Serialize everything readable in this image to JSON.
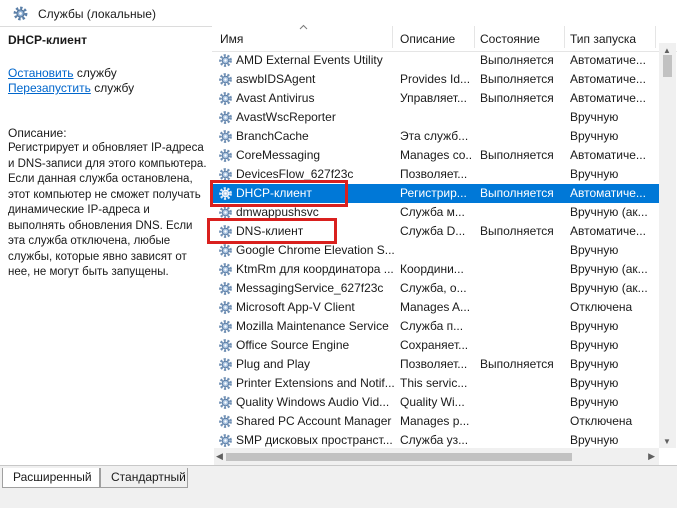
{
  "window": {
    "title": "Службы (локальные)",
    "title_icon": "gear-icon"
  },
  "left_pane": {
    "service_title": "DHCP-клиент",
    "actions": [
      {
        "link": "Остановить",
        "rest": " службу"
      },
      {
        "link": "Перезапустить",
        "rest": " службу"
      }
    ],
    "description_label": "Описание:",
    "description": "Регистрирует и обновляет IP-адреса и DNS-записи для этого компьютера. Если данная служба остановлена, этот компьютер не сможет получать динамические IP-адреса и выполнять обновления DNS. Если эта служба отключена, любые службы, которые явно зависят от нее, не могут быть запущены."
  },
  "columns": {
    "name": "Имя",
    "description": "Описание",
    "state": "Состояние",
    "startup": "Тип запуска"
  },
  "services": [
    {
      "name": "AMD External Events Utility",
      "description": "",
      "state": "Выполняется",
      "startup": "Автоматиче..."
    },
    {
      "name": "aswbIDSAgent",
      "description": "Provides Id...",
      "state": "Выполняется",
      "startup": "Автоматиче..."
    },
    {
      "name": "Avast Antivirus",
      "description": "Управляет...",
      "state": "Выполняется",
      "startup": "Автоматиче..."
    },
    {
      "name": "AvastWscReporter",
      "description": "",
      "state": "",
      "startup": "Вручную"
    },
    {
      "name": "BranchCache",
      "description": "Эта служб...",
      "state": "",
      "startup": "Вручную"
    },
    {
      "name": "CoreMessaging",
      "description": "Manages co...",
      "state": "Выполняется",
      "startup": "Автоматиче..."
    },
    {
      "name": "DevicesFlow_627f23c",
      "description": "Позволяет...",
      "state": "",
      "startup": "Вручную"
    },
    {
      "name": "DHCP-клиент",
      "description": "Регистрир...",
      "state": "Выполняется",
      "startup": "Автоматиче...",
      "selected": true
    },
    {
      "name": "dmwappushsvc",
      "description": "Служба м...",
      "state": "",
      "startup": "Вручную (ак..."
    },
    {
      "name": "DNS-клиент",
      "description": "Служба D...",
      "state": "Выполняется",
      "startup": "Автоматиче..."
    },
    {
      "name": "Google Chrome Elevation S...",
      "description": "",
      "state": "",
      "startup": "Вручную"
    },
    {
      "name": "KtmRm для координатора ...",
      "description": "Координи...",
      "state": "",
      "startup": "Вручную (ак..."
    },
    {
      "name": "MessagingService_627f23c",
      "description": "Служба, о...",
      "state": "",
      "startup": "Вручную (ак..."
    },
    {
      "name": "Microsoft App-V Client",
      "description": "Manages A...",
      "state": "",
      "startup": "Отключена"
    },
    {
      "name": "Mozilla Maintenance Service",
      "description": "Служба п...",
      "state": "",
      "startup": "Вручную"
    },
    {
      "name": "Office  Source Engine",
      "description": "Сохраняет...",
      "state": "",
      "startup": "Вручную"
    },
    {
      "name": "Plug and Play",
      "description": "Позволяет...",
      "state": "Выполняется",
      "startup": "Вручную"
    },
    {
      "name": "Printer Extensions and Notif...",
      "description": "This servic...",
      "state": "",
      "startup": "Вручную"
    },
    {
      "name": "Quality Windows Audio Vid...",
      "description": "Quality Wi...",
      "state": "",
      "startup": "Вручную"
    },
    {
      "name": "Shared PC Account Manager",
      "description": "Manages p...",
      "state": "",
      "startup": "Отключена"
    },
    {
      "name": "SMP дисковых пространст...",
      "description": "Служба уз...",
      "state": "",
      "startup": "Вручную"
    }
  ],
  "tabs": [
    "Расширенный",
    "Стандартный"
  ],
  "colors": {
    "selection": "#0078d7",
    "link": "#0066cc",
    "highlight_box": "#d9201e"
  }
}
